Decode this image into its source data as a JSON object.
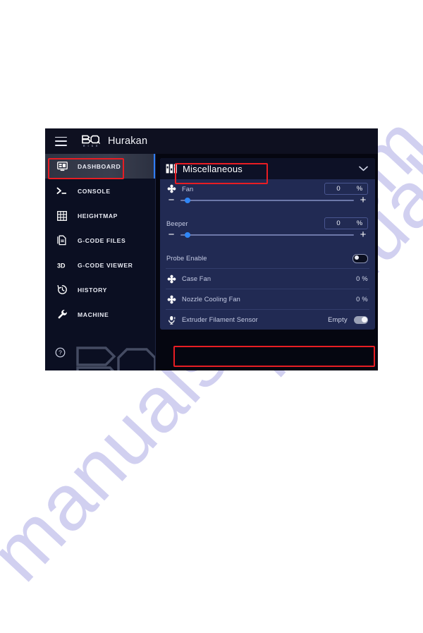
{
  "watermark": {
    "line1": "manualslive.com",
    "line2": "manualslive.com",
    "color": "#c9c8ee"
  },
  "app": {
    "topbar": {
      "menu_icon": "hamburger-icon",
      "logo_text": "BQ",
      "logo_subtext": "R I S E",
      "title": "Hurakan"
    },
    "sidebar": {
      "items": [
        {
          "label": "DASHBOARD",
          "icon": "dashboard-icon",
          "active": true
        },
        {
          "label": "CONSOLE",
          "icon": "console-icon",
          "active": false
        },
        {
          "label": "HEIGHTMAP",
          "icon": "grid-icon",
          "active": false
        },
        {
          "label": "G-CODE FILES",
          "icon": "files-icon",
          "active": false
        },
        {
          "label": "G-CODE VIEWER",
          "icon": "3d-icon",
          "active": false
        },
        {
          "label": "HISTORY",
          "icon": "history-icon",
          "active": false
        },
        {
          "label": "MACHINE",
          "icon": "wrench-icon",
          "active": false
        }
      ],
      "help_icon": "help-circle-icon",
      "accent_color": "#2f7df6"
    },
    "panel": {
      "title": "Miscellaneous",
      "title_icon": "tune-sliders-icon",
      "collapse_icon": "chevron-down-icon",
      "controls": [
        {
          "type": "slider",
          "label": "Fan",
          "icon": "fan-icon",
          "value": "0",
          "unit": "%",
          "minus_label": "−",
          "plus_label": "+",
          "slider_percent": 4
        },
        {
          "type": "slider",
          "label": "Beeper",
          "icon": "none",
          "value": "0",
          "unit": "%",
          "minus_label": "−",
          "plus_label": "+",
          "slider_percent": 4
        },
        {
          "type": "toggle",
          "label": "Probe Enable",
          "icon": "none",
          "state": "off",
          "status": ""
        },
        {
          "type": "readout",
          "label": "Case Fan",
          "icon": "fan-icon",
          "value": "0 %"
        },
        {
          "type": "readout",
          "label": "Nozzle Cooling Fan",
          "icon": "fan-icon",
          "value": "0 %"
        },
        {
          "type": "toggle",
          "label": "Extruder Filament Sensor",
          "icon": "filament-sensor-icon",
          "state": "on",
          "status": "Empty"
        }
      ]
    }
  },
  "highlights": {
    "color": "#e81d23",
    "boxes": [
      "dashboard-menu-item",
      "miscellaneous-panel-title",
      "extruder-filament-sensor-row"
    ]
  }
}
